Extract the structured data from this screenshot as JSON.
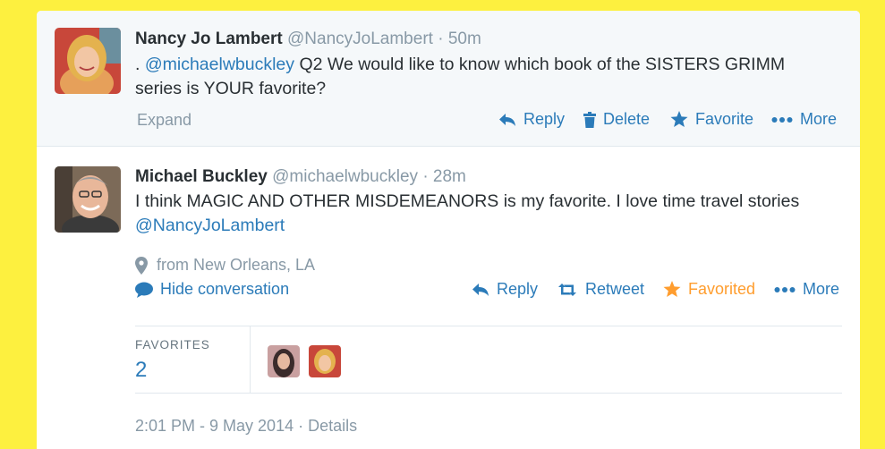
{
  "colors": {
    "page_background": "#fdf03f",
    "link": "#2b7bb9",
    "favorited": "#ff9d2e",
    "muted": "#8899a6"
  },
  "tweet1": {
    "name": "Nancy Jo Lambert",
    "handle": "@NancyJoLambert",
    "separator": "·",
    "time": "50m",
    "text_prefix": ". ",
    "mention": "@michaelwbuckley",
    "text_rest": " Q2 We would like to know which book of the SISTERS GRIMM series is YOUR favorite?",
    "expand": "Expand",
    "actions": {
      "reply": "Reply",
      "delete": "Delete",
      "favorite": "Favorite",
      "more": "More"
    }
  },
  "tweet2": {
    "name": "Michael Buckley",
    "handle": "@michaelwbuckley",
    "separator": "·",
    "time": "28m",
    "text_main": "I think MAGIC AND OTHER MISDEMEANORS is my favorite.  I love time travel stories ",
    "mention": "@NancyJoLambert",
    "location": "from New Orleans, LA",
    "hide_conversation": "Hide conversation",
    "actions": {
      "reply": "Reply",
      "retweet": "Retweet",
      "favorited": "Favorited",
      "more": "More"
    },
    "stats": {
      "favorites_label": "FAVORITES",
      "favorites_count": "2"
    },
    "timestamp": "2:01 PM - 9 May 2014",
    "details_separator": "·",
    "details": "Details"
  }
}
